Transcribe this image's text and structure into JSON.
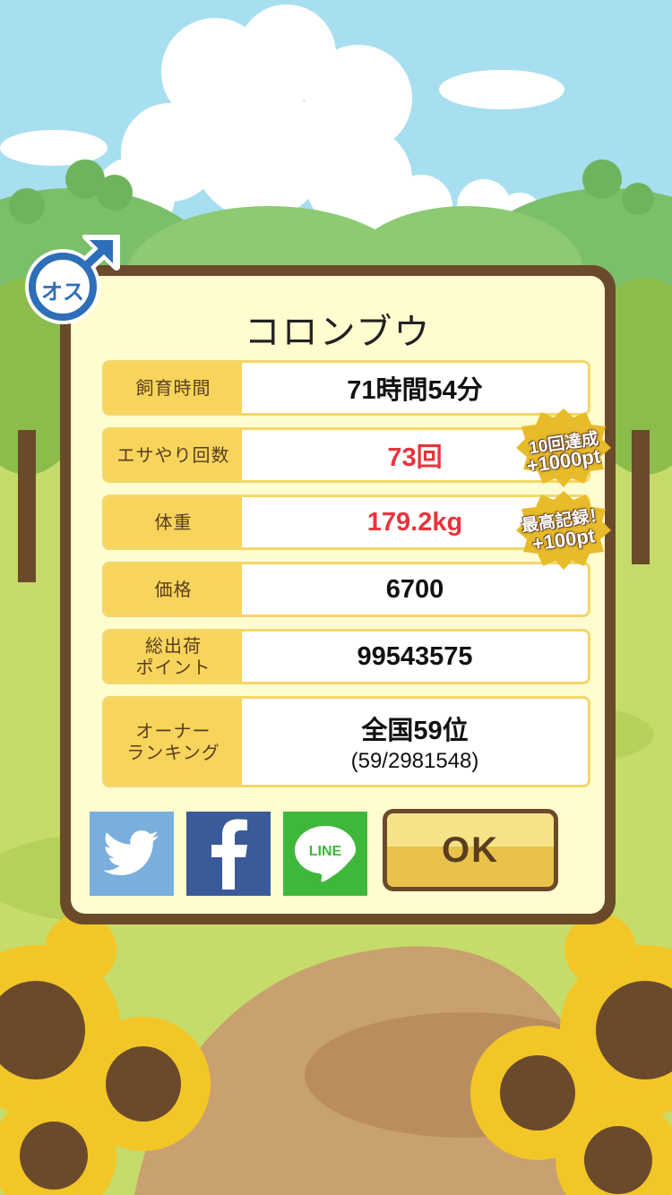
{
  "gender_badge": {
    "label": "オス"
  },
  "dialog": {
    "title": "コロンブウ",
    "rows": [
      {
        "label": "飼育時間",
        "value": "71時間54分"
      },
      {
        "label": "エサやり回数",
        "value": "73回"
      },
      {
        "label": "体重",
        "value": "179.2kg"
      },
      {
        "label": "価格",
        "value": "6700"
      },
      {
        "label": "総出荷\nポイント",
        "value": "99543575"
      },
      {
        "label": "オーナー\nランキング",
        "value": "全国59位",
        "sub": "(59/2981548)"
      }
    ],
    "badges": [
      {
        "line1": "10回達成",
        "line2": "+1000pt"
      },
      {
        "line1": "最高記録！",
        "line2": "+100pt"
      }
    ],
    "social": {
      "line_label": "LINE"
    },
    "ok_label": "OK"
  },
  "colors": {
    "value_highlight": "#e8343c",
    "frame": "#6b4a2c",
    "label_bg": "#f7d45c",
    "panel_bg": "#fffdd0"
  }
}
